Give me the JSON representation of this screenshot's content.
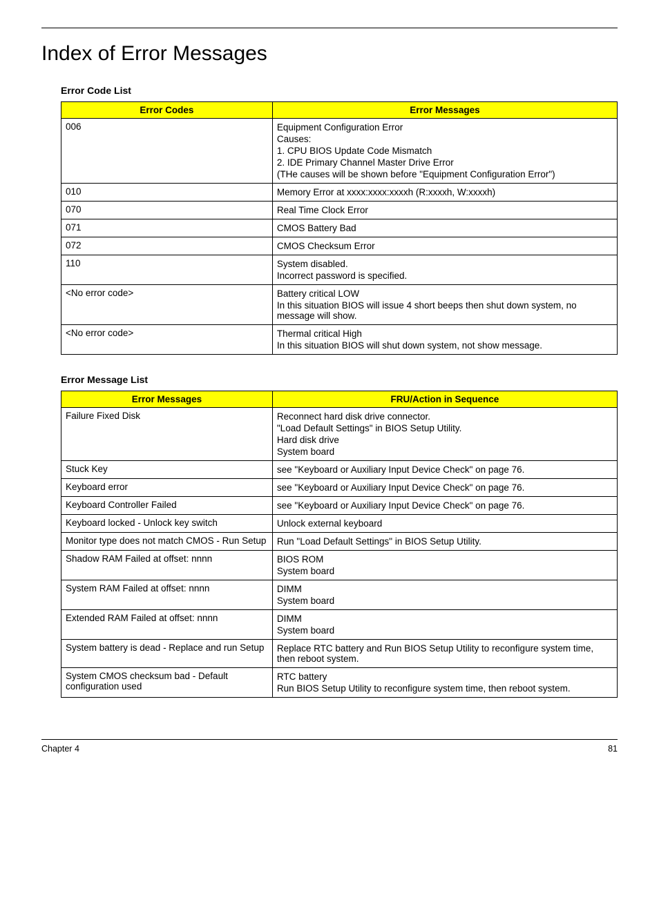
{
  "title": "Index of Error Messages",
  "table1": {
    "caption": "Error Code List",
    "headers": [
      "Error Codes",
      "Error Messages"
    ],
    "rows": [
      {
        "c1": "006",
        "c2": [
          "Equipment Configuration Error",
          "Causes:",
          "1. CPU BIOS Update Code Mismatch",
          "2. IDE Primary Channel Master Drive Error",
          "(THe causes will be shown before \"Equipment Configuration Error\")"
        ]
      },
      {
        "c1": "010",
        "c2": [
          "Memory Error at xxxx:xxxx:xxxxh (R:xxxxh, W:xxxxh)"
        ]
      },
      {
        "c1": "070",
        "c2": [
          "Real Time Clock Error"
        ]
      },
      {
        "c1": "071",
        "c2": [
          "CMOS Battery Bad"
        ]
      },
      {
        "c1": "072",
        "c2": [
          "CMOS Checksum Error"
        ]
      },
      {
        "c1": "110",
        "c2": [
          "System disabled.",
          "Incorrect password is specified."
        ]
      },
      {
        "c1": "<No error code>",
        "c2": [
          "Battery critical LOW",
          "In this situation BIOS will issue 4 short beeps then shut down system, no message will show."
        ]
      },
      {
        "c1": "<No error code>",
        "c2": [
          "Thermal critical High",
          "In this situation BIOS will shut down system, not show message."
        ]
      }
    ]
  },
  "table2": {
    "caption": "Error Message List",
    "headers": [
      "Error Messages",
      "FRU/Action in Sequence"
    ],
    "rows": [
      {
        "c1": "Failure Fixed Disk",
        "c2": [
          "Reconnect hard disk drive connector.",
          "\"Load Default Settings\" in BIOS Setup Utility.",
          "Hard disk drive",
          "System board"
        ]
      },
      {
        "c1": "Stuck Key",
        "c2": [
          "see \"Keyboard or Auxiliary Input Device Check\" on page 76."
        ]
      },
      {
        "c1": "Keyboard error",
        "c2": [
          "see \"Keyboard or Auxiliary Input Device Check\" on page 76."
        ]
      },
      {
        "c1": "Keyboard Controller Failed",
        "c2": [
          "see \"Keyboard or Auxiliary Input Device Check\" on page 76."
        ]
      },
      {
        "c1": "Keyboard locked - Unlock key switch",
        "c2": [
          "Unlock external keyboard"
        ]
      },
      {
        "c1": "Monitor type does not match CMOS - Run Setup",
        "c2": [
          "Run \"Load Default Settings\" in BIOS Setup Utility."
        ]
      },
      {
        "c1": "Shadow RAM Failed at offset: nnnn",
        "c2": [
          "BIOS ROM",
          "System board"
        ]
      },
      {
        "c1": "System RAM Failed at offset: nnnn",
        "c2": [
          "DIMM",
          "System board"
        ]
      },
      {
        "c1": "Extended RAM Failed at offset: nnnn",
        "c2": [
          "DIMM",
          "System board"
        ]
      },
      {
        "c1": "System battery is dead - Replace and run Setup",
        "c2": [
          "Replace RTC battery and Run BIOS Setup Utility to reconfigure system time, then reboot system."
        ]
      },
      {
        "c1": "System CMOS checksum bad - Default configuration used",
        "c2": [
          "RTC battery",
          "Run BIOS Setup Utility to reconfigure system time, then reboot system."
        ]
      }
    ]
  },
  "footer": {
    "left": "Chapter 4",
    "right": "81"
  }
}
